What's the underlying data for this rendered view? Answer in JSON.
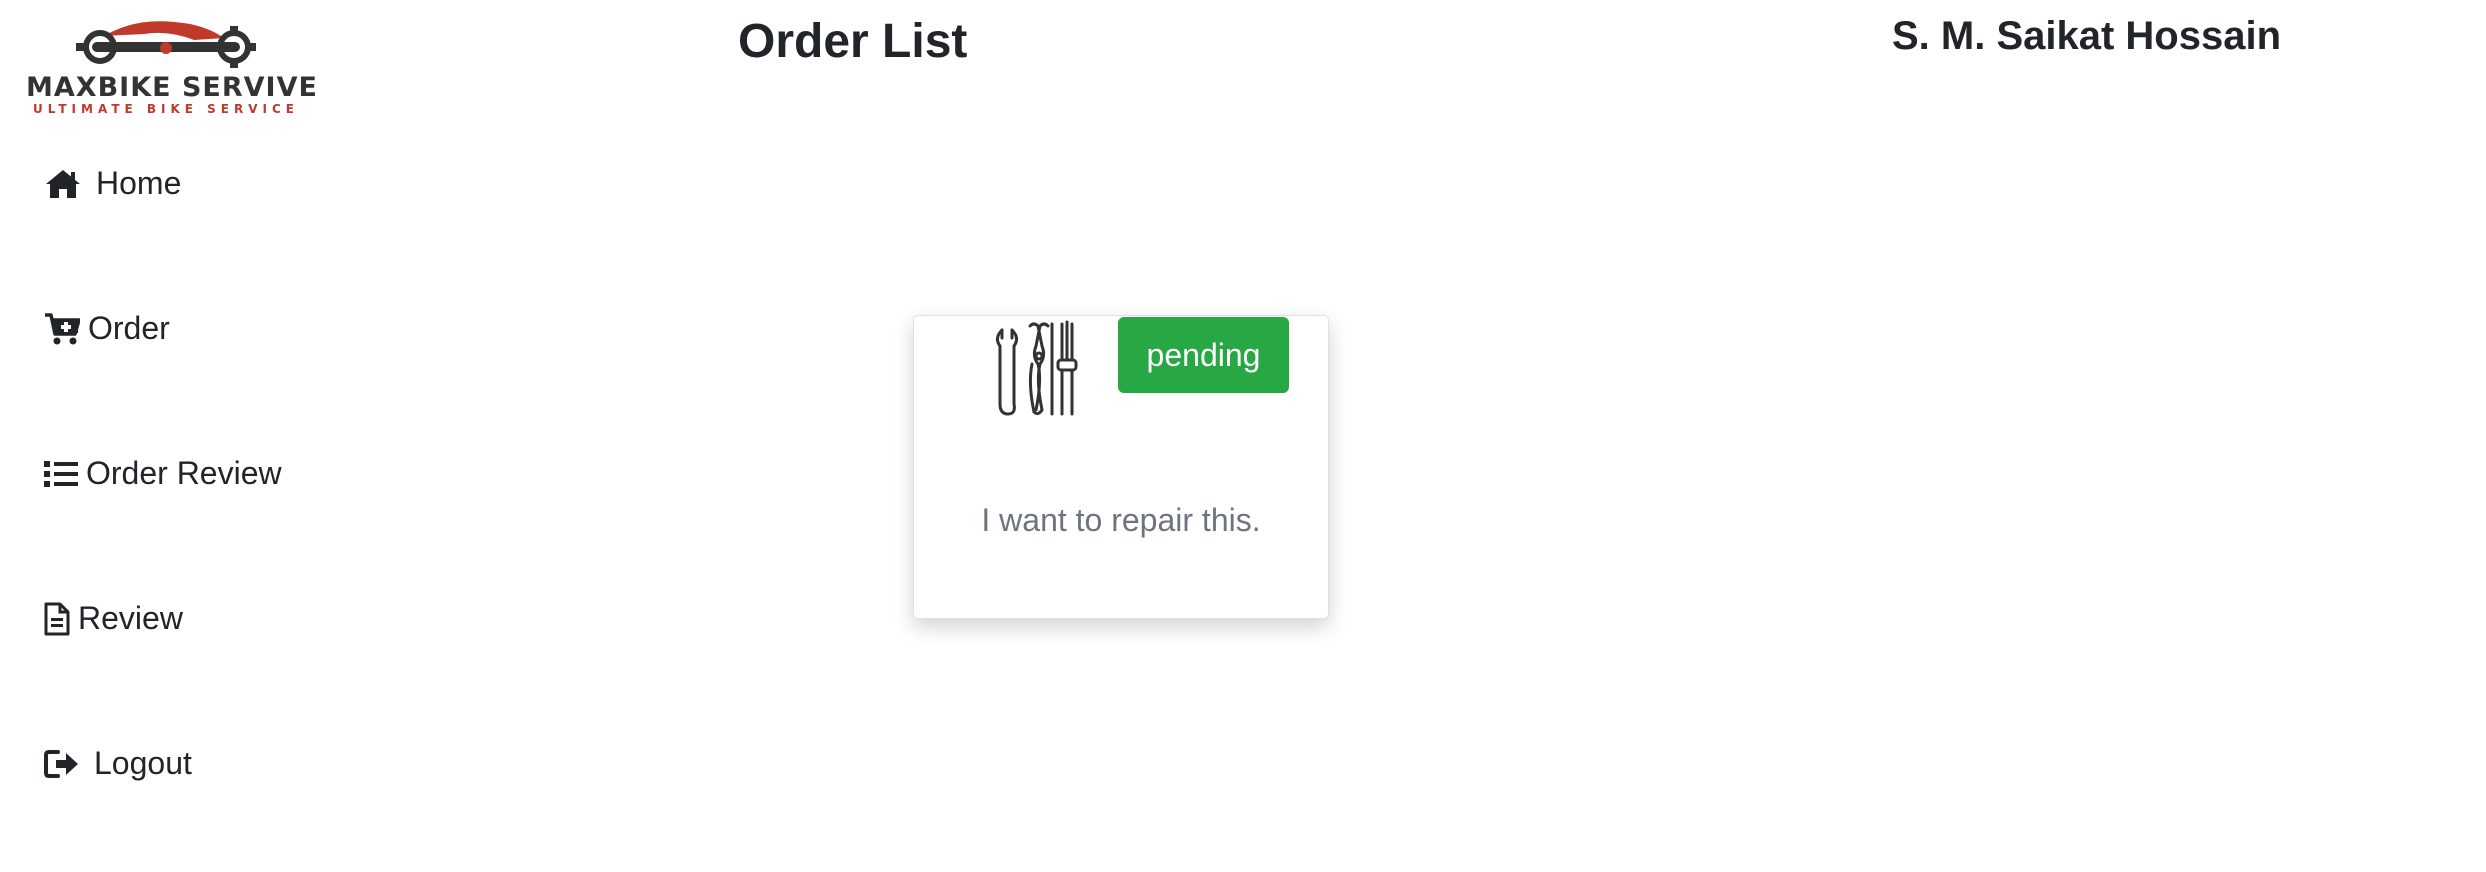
{
  "logo": {
    "line1": "MAXBIKE SERVIVE",
    "line2": "ULTIMATE BIKE SERVICE",
    "icon": "bike-wrench-logo-icon",
    "brand_color": "#c0392b"
  },
  "header": {
    "title": "Order List",
    "user_name": "S. M. Saikat Hossain"
  },
  "sidebar": {
    "items": [
      {
        "label": "Home",
        "icon": "home-icon"
      },
      {
        "label": "Order",
        "icon": "cart-plus-icon"
      },
      {
        "label": "Order Review",
        "icon": "list-icon"
      },
      {
        "label": "Review",
        "icon": "file-alt-icon"
      },
      {
        "label": "Logout",
        "icon": "sign-out-icon"
      }
    ]
  },
  "orders": [
    {
      "status": "pending",
      "status_color": "#28a745",
      "description": "I want to repair this.",
      "icon": "tools-icon"
    }
  ]
}
